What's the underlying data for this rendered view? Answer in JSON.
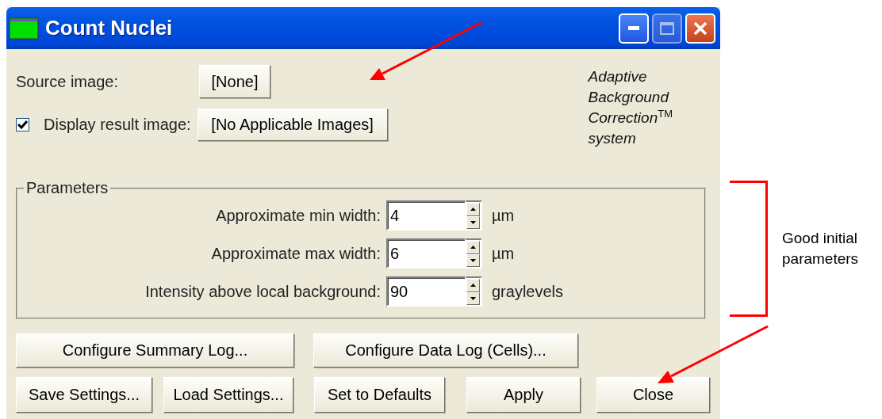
{
  "window": {
    "title": "Count Nuclei"
  },
  "source_image": {
    "label": "Source image:",
    "button": "[None]"
  },
  "display_result": {
    "checked": true,
    "label": "Display result image:",
    "button": "[No Applicable Images]"
  },
  "branding": {
    "text": "Adaptive\nBackground\nCorrection$^{TM}$\nsystem"
  },
  "parameters": {
    "title": "Parameters",
    "fields": [
      {
        "label": "Approximate min width:",
        "value": "4",
        "unit": "µm"
      },
      {
        "label": "Approximate max width:",
        "value": "6",
        "unit": "µm"
      },
      {
        "label": "Intensity above local background:",
        "value": "90",
        "unit": "graylevels"
      }
    ]
  },
  "log_buttons": [
    "Configure Summary Log...",
    "Configure Data Log (Cells)..."
  ],
  "action_buttons": [
    "Save Settings...",
    "Load Settings...",
    "Set to Defaults",
    "Apply",
    "Close"
  ],
  "annotation": {
    "text": "Good initial\nparameters"
  }
}
